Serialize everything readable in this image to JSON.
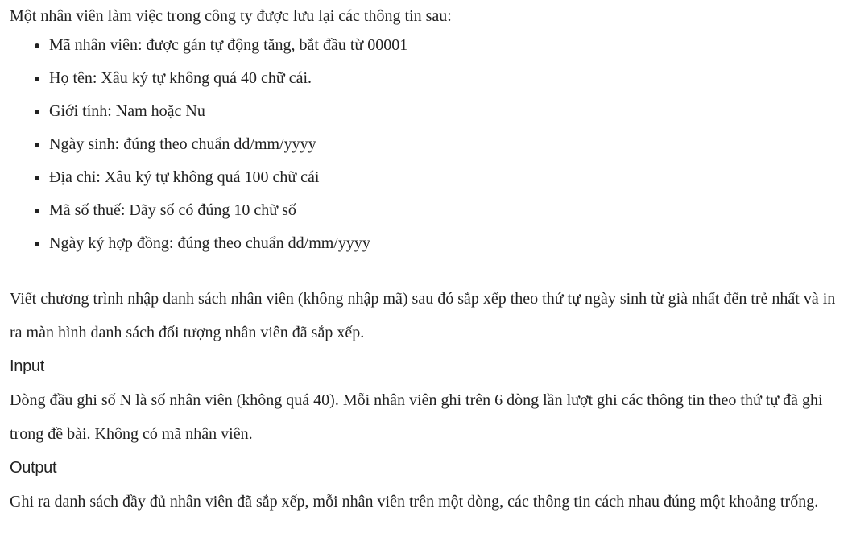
{
  "intro": "Một nhân viên làm việc trong công ty được lưu lại các thông tin sau:",
  "attributes": [
    "Mã nhân viên: được gán tự động tăng, bắt đầu từ 00001",
    "Họ tên: Xâu ký tự không quá 40 chữ cái.",
    "Giới tính: Nam hoặc Nu",
    "Ngày sinh: đúng theo chuẩn dd/mm/yyyy",
    "Địa chỉ: Xâu ký tự không quá 100 chữ cái",
    "Mã số thuế: Dãy số có đúng 10 chữ số",
    "Ngày ký hợp đồng: đúng theo chuẩn dd/mm/yyyy"
  ],
  "task": "Viết chương trình nhập danh sách nhân viên (không nhập mã) sau đó sắp xếp theo thứ tự ngày sinh từ già nhất đến trẻ nhất và in ra màn hình danh sách đối tượng nhân viên đã sắp xếp.",
  "input": {
    "heading": "Input",
    "text": "Dòng đầu ghi số N là số nhân viên (không quá 40). Mỗi nhân viên ghi trên 6 dòng lần lượt ghi các thông tin theo thứ tự đã ghi trong đề bài. Không có mã nhân viên."
  },
  "output": {
    "heading": "Output",
    "text": "Ghi ra danh sách đầy đủ nhân viên đã sắp xếp, mỗi nhân viên trên một dòng, các thông tin cách nhau đúng một khoảng trống."
  }
}
